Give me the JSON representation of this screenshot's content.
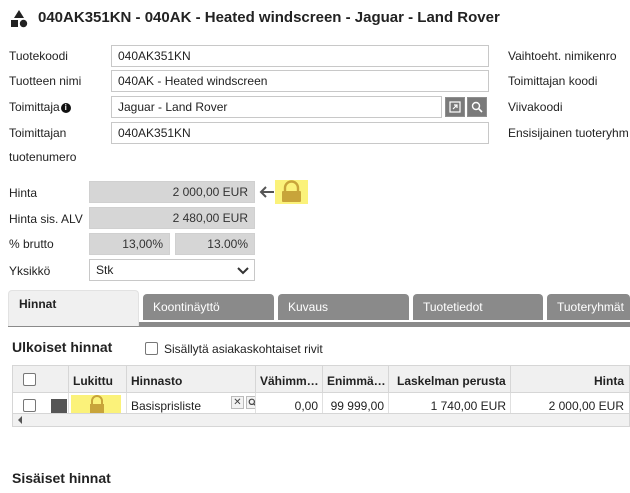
{
  "header": {
    "title": "040AK351KN - 040AK - Heated windscreen - Jaguar - Land Rover",
    "icon": "shapes-icon"
  },
  "form": {
    "product_code": {
      "label": "Tuotekoodi",
      "value": "040AK351KN"
    },
    "product_name": {
      "label": "Tuotteen nimi",
      "value": "040AK - Heated windscreen"
    },
    "supplier": {
      "label": "Toimittaja",
      "value": "Jaguar - Land Rover"
    },
    "supplier_number": {
      "label_line1": "Toimittajan",
      "label_line2": "tuotenumero",
      "value": "040AK351KN"
    },
    "right_labels": {
      "alt_name_code": "Vaihtoeht. nimikenro",
      "supplier_code": "Toimittajan koodi",
      "barcode": "Viivakoodi",
      "primary_group": "Ensisijainen tuoteryhm"
    }
  },
  "pricing": {
    "price": {
      "label": "Hinta",
      "value": "2 000,00 EUR"
    },
    "price_vat": {
      "label": "Hinta sis. ALV",
      "value": "2 480,00 EUR"
    },
    "gross": {
      "label": "% brutto",
      "value1": "13,00%",
      "value2": "13.00%"
    },
    "unit": {
      "label": "Yksikkö",
      "value": "Stk"
    }
  },
  "tabs": [
    {
      "label": "Hinnat",
      "active": true
    },
    {
      "label": "Koontinäyttö",
      "active": false
    },
    {
      "label": "Kuvaus",
      "active": false
    },
    {
      "label": "Tuotetiedot",
      "active": false
    },
    {
      "label": "Tuoteryhmät",
      "active": false
    }
  ],
  "external_prices": {
    "title": "Ulkoiset hinnat",
    "include_customer_rows_label": "Sisällytä asiakaskohtaiset rivit",
    "columns": [
      "Lukittu",
      "Hinnasto",
      "Vähimm…",
      "Enimmä…",
      "Laskelman perusta",
      "Hinta"
    ],
    "rows": [
      {
        "pricelist": "Basisprisliste",
        "min": "0,00",
        "max": "99 999,00",
        "basis": "1 740,00 EUR",
        "price": "2 000,00 EUR"
      }
    ]
  },
  "internal_prices": {
    "title": "Sisäiset hinnat"
  },
  "colors": {
    "highlight": "#fbf27a",
    "tab_bg": "#8a8a8a",
    "readonly_bg": "#d6d6d6",
    "lock": "#c8a43a"
  }
}
